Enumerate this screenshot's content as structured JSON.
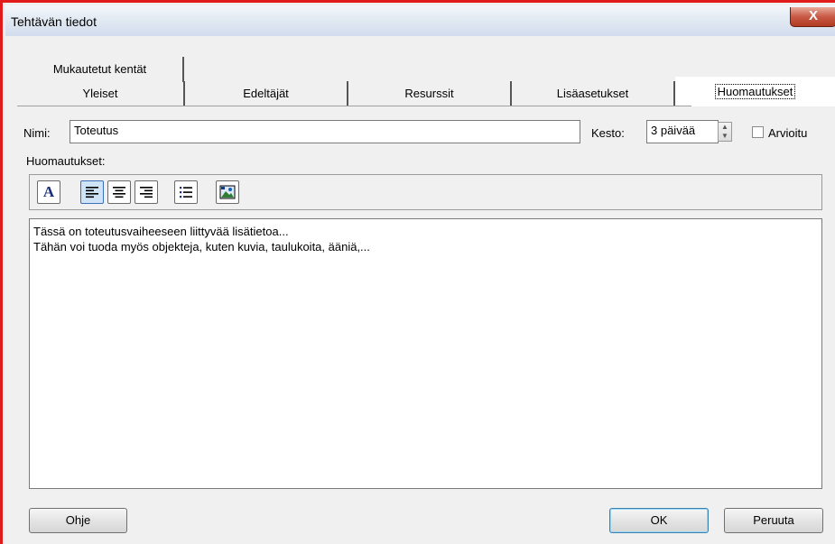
{
  "window": {
    "title": "Tehtävän tiedot",
    "close_glyph": "X"
  },
  "tabs_row1": [
    {
      "label": "Mukautetut kentät"
    }
  ],
  "tabs_row2": [
    {
      "label": "Yleiset"
    },
    {
      "label": "Edeltäjät"
    },
    {
      "label": "Resurssit"
    },
    {
      "label": "Lisäasetukset"
    },
    {
      "label": "Huomautukset",
      "active": true
    }
  ],
  "fields": {
    "name_label": "Nimi:",
    "name_value": "Toteutus",
    "duration_label": "Kesto:",
    "duration_value": "3 päivää",
    "estimated_label": "Arvioitu"
  },
  "notes": {
    "label": "Huomautukset:",
    "lines": [
      "Tässä on toteutusvaiheeseen liittyvää lisätietoa...",
      "Tähän voi tuoda myös objekteja, kuten kuvia, taulukoita, ääniä,..."
    ]
  },
  "toolbar": {
    "items": [
      {
        "name": "font-icon",
        "glyph": "A"
      },
      {
        "name": "align-left-icon"
      },
      {
        "name": "align-center-icon"
      },
      {
        "name": "align-right-icon"
      },
      {
        "name": "bullet-list-icon"
      },
      {
        "name": "insert-object-icon"
      }
    ]
  },
  "buttons": {
    "help": "Ohje",
    "ok": "OK",
    "cancel": "Peruuta"
  },
  "colors": {
    "accent_red": "#e11b1b",
    "close_red": "#c95a45",
    "default_button_border": "#3c7fb1"
  }
}
